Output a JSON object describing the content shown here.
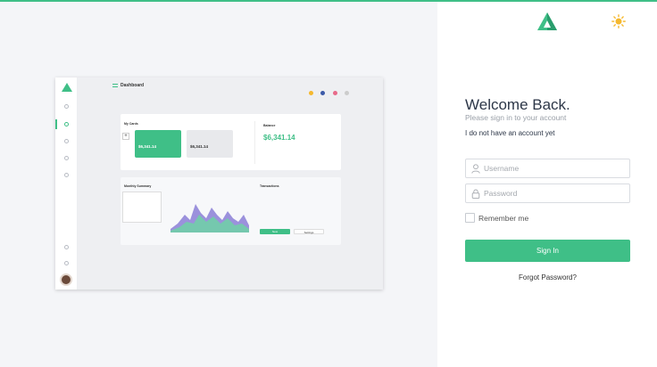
{
  "login": {
    "welcome": "Welcome Back.",
    "subtitle": "Please sign in to your account",
    "no_account": "I do not have an account yet",
    "username_placeholder": "Username",
    "password_placeholder": "Password",
    "remember": "Remember me",
    "sign_in": "Sign In",
    "forgot": "Forgot Password?"
  },
  "preview": {
    "header_title": "Dashboard",
    "my_cards": "My Cards",
    "card1_value": "$6,341.14",
    "card2_value": "$6,341.14",
    "balance_label": "Balance",
    "balance_value": "$6,341.14",
    "monthly_summary": "Monthly Summary",
    "transactions": "Transactions",
    "btn_new": "New",
    "btn_settings": "Settings"
  },
  "colors": {
    "accent": "#3fbf87",
    "sun": "#f5b82e"
  }
}
